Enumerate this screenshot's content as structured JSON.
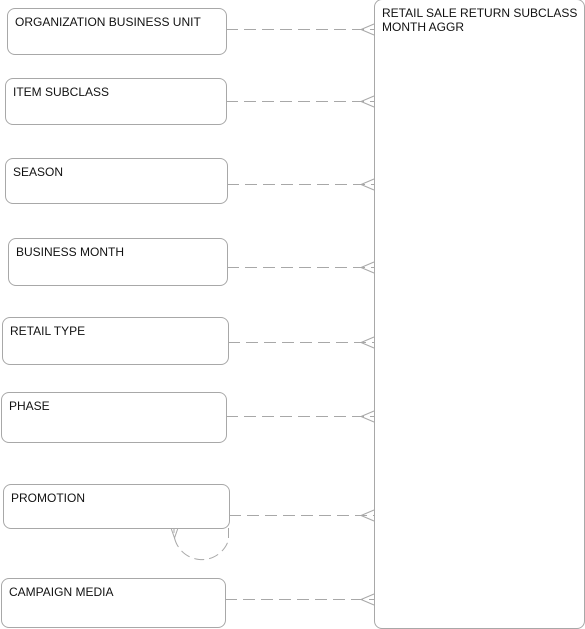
{
  "diagram": {
    "fact_entity": {
      "name": "RETAIL SALE RETURN SUBCLASS MONTH AGGR"
    },
    "dimension_entities": [
      {
        "name": "ORGANIZATION BUSINESS UNIT"
      },
      {
        "name": "ITEM SUBCLASS"
      },
      {
        "name": "SEASON"
      },
      {
        "name": "BUSINESS MONTH"
      },
      {
        "name": "RETAIL TYPE"
      },
      {
        "name": "PHASE"
      },
      {
        "name": "PROMOTION",
        "self_relationship": true
      },
      {
        "name": "CAMPAIGN MEDIA"
      }
    ],
    "relationships": [
      {
        "from": "ORGANIZATION BUSINESS UNIT",
        "to": "RETAIL SALE RETURN SUBCLASS MONTH AGGR",
        "cardinality": "one-to-many",
        "style": "dashed"
      },
      {
        "from": "ITEM SUBCLASS",
        "to": "RETAIL SALE RETURN SUBCLASS MONTH AGGR",
        "cardinality": "one-to-many",
        "style": "dashed"
      },
      {
        "from": "SEASON",
        "to": "RETAIL SALE RETURN SUBCLASS MONTH AGGR",
        "cardinality": "one-to-many",
        "style": "dashed"
      },
      {
        "from": "BUSINESS MONTH",
        "to": "RETAIL SALE RETURN SUBCLASS MONTH AGGR",
        "cardinality": "one-to-many",
        "style": "dashed"
      },
      {
        "from": "RETAIL TYPE",
        "to": "RETAIL SALE RETURN SUBCLASS MONTH AGGR",
        "cardinality": "one-to-many",
        "style": "dashed"
      },
      {
        "from": "PHASE",
        "to": "RETAIL SALE RETURN SUBCLASS MONTH AGGR",
        "cardinality": "one-to-many",
        "style": "dashed"
      },
      {
        "from": "PROMOTION",
        "to": "RETAIL SALE RETURN SUBCLASS MONTH AGGR",
        "cardinality": "one-to-many",
        "style": "dashed"
      },
      {
        "from": "CAMPAIGN MEDIA",
        "to": "RETAIL SALE RETURN SUBCLASS MONTH AGGR",
        "cardinality": "one-to-many",
        "style": "dashed"
      },
      {
        "from": "PROMOTION",
        "to": "PROMOTION",
        "cardinality": "one-to-many",
        "style": "dashed"
      }
    ],
    "colors": {
      "line": "#a8a8a8",
      "text": "#111111",
      "background": "#ffffff"
    }
  }
}
